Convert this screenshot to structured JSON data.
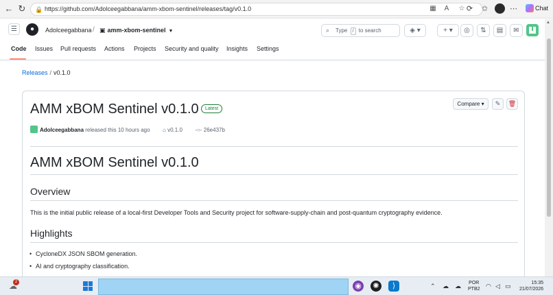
{
  "browser": {
    "url": "https://github.com/Adolceegabbana/amm-xbom-sentinel/releases/tag/v0.1.0",
    "chat_label": "Chat"
  },
  "header": {
    "owner": "Adolceegabbana",
    "repo": "amm-xbom-sentinel",
    "search_prefix": "Type",
    "search_key": "/",
    "search_suffix": "to search"
  },
  "tabs": [
    "Code",
    "Issues",
    "Pull requests",
    "Actions",
    "Projects",
    "Security and quality",
    "Insights",
    "Settings"
  ],
  "breadcrumb": {
    "releases": "Releases",
    "separator": "/",
    "current": "v0.1.0"
  },
  "release": {
    "title": "AMM xBOM Sentinel v0.1.0",
    "badge": "Latest",
    "compare_label": "Compare",
    "author": "Adolceegabbana",
    "released_text": "released this 10 hours ago",
    "tag": "v0.1.0",
    "commit": "26e437b"
  },
  "body": {
    "h1": "AMM xBOM Sentinel v0.1.0",
    "overview_heading": "Overview",
    "overview_text": "This is the initial public release of a local-first Developer Tools and Security project for software-supply-chain and post-quantum cryptography evidence.",
    "highlights_heading": "Highlights",
    "highlights": [
      "CycloneDX JSON SBOM generation.",
      "AI and cryptography classification."
    ]
  },
  "taskbar": {
    "notification_count": "2",
    "lang_line1": "POR",
    "lang_line2": "PTB2",
    "time": "15:35",
    "date": "21/07/2026"
  },
  "colors": {
    "accent": "#0969da",
    "latest_green": "#1a7f37",
    "tab_underline": "#fd8c73",
    "taskbar_search": "#9fd4f4"
  }
}
